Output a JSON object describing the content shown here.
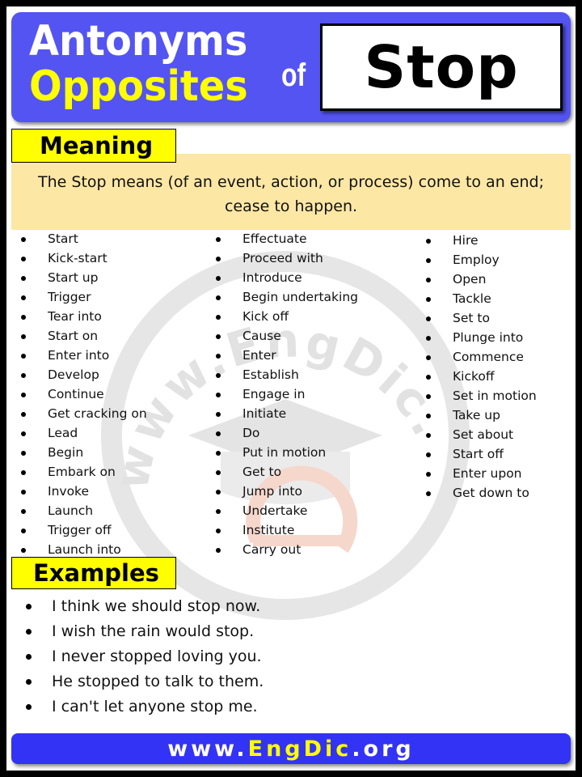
{
  "header": {
    "title_line1": "Antonyms",
    "title_line2": "Opposites",
    "connector": "of",
    "word": "Stop"
  },
  "colors": {
    "header_bg": "#5454f3",
    "title_line1": "#ffffff",
    "title_line2": "#ffff00",
    "label_bg": "#ffff00",
    "meaning_bg": "#fde7a4",
    "footer_bg": "#3333f5",
    "footer_accent": "#ffff00"
  },
  "meaning": {
    "label": "Meaning",
    "text": "The Stop means (of an event, action, or process) come to an end; cease to happen."
  },
  "antonyms": {
    "column1": [
      "Start",
      "Kick-start",
      "Start up",
      "Trigger",
      "Tear into",
      "Start on",
      "Enter into",
      "Develop",
      "Continue",
      "Get cracking on",
      "Lead",
      "Begin",
      "Embark on",
      "Invoke",
      "Launch",
      "Trigger off",
      "Launch into"
    ],
    "column2": [
      "Effectuate",
      "Proceed with",
      "Introduce",
      "Begin undertaking",
      "Kick off",
      "Cause",
      "Enter",
      "Establish",
      "Engage in",
      "Initiate",
      "Do",
      "Put in motion",
      "Get to",
      "Jump into",
      "Undertake",
      "Institute",
      "Carry out"
    ],
    "column3": [
      "Hire",
      "Employ",
      "Open",
      "Tackle",
      "Set to",
      "Plunge into",
      "Commence",
      "Kickoff",
      "Set in motion",
      "Take up",
      "Set about",
      "Start off",
      "Enter upon",
      "Get down to"
    ]
  },
  "examples": {
    "label": "Examples",
    "items": [
      "I think we should stop now.",
      "I wish the rain would stop.",
      "I never stopped loving you.",
      "He stopped to talk to them.",
      "I can't let anyone stop me."
    ]
  },
  "footer": {
    "prefix": "www.",
    "brand": "EngDic",
    "suffix": ".org"
  },
  "watermark": {
    "text": "www.EngDic.org",
    "icon": "graduation-cap-logo-icon"
  }
}
